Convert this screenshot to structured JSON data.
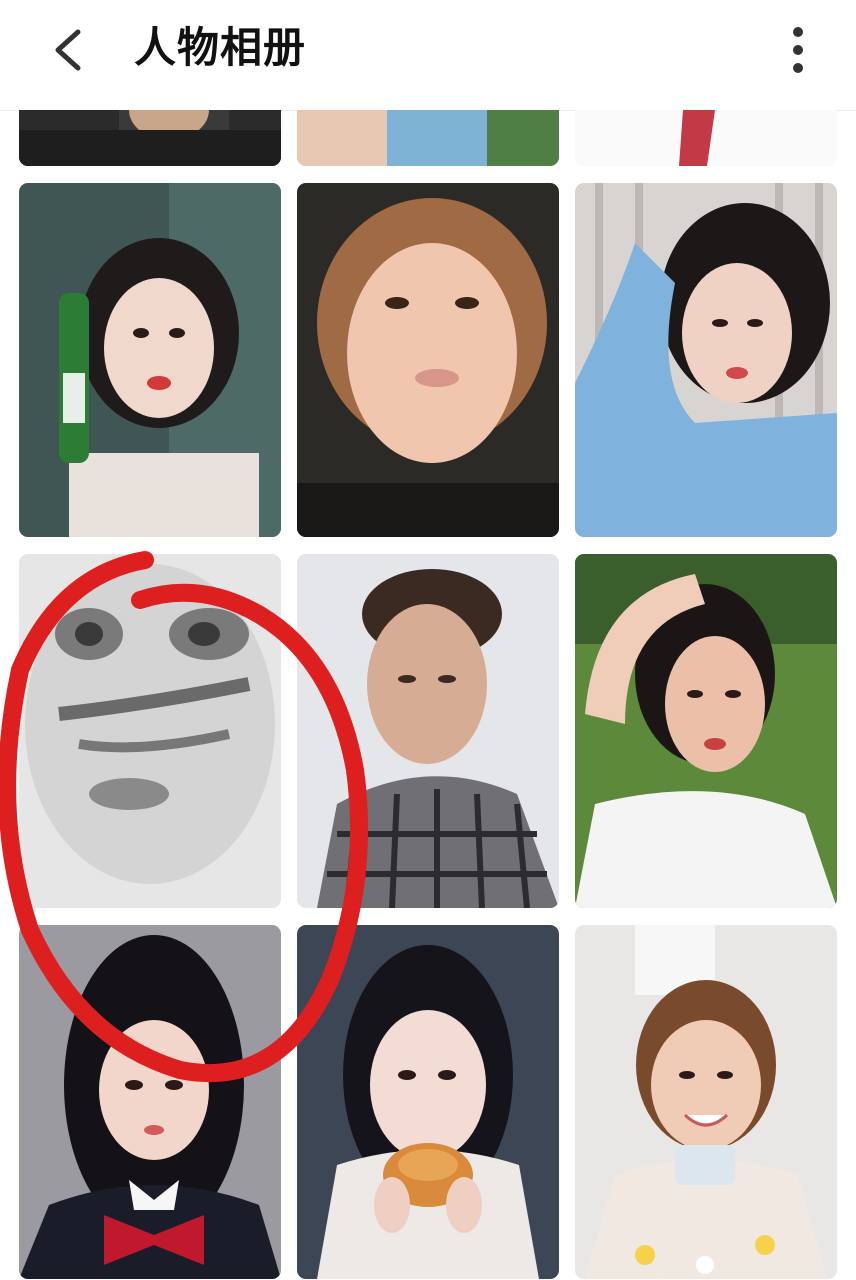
{
  "header": {
    "title": "人物相册",
    "back_icon": "chevron-left-icon",
    "more_icon": "more-vertical-icon"
  },
  "grid": {
    "columns": 3,
    "photos": [
      {
        "name": "photo-partial-1",
        "kind": "portrait-dark"
      },
      {
        "name": "photo-partial-2",
        "kind": "portrait-blue"
      },
      {
        "name": "photo-partial-3",
        "kind": "portrait-light"
      },
      {
        "name": "photo-woman-bottle",
        "kind": "portrait"
      },
      {
        "name": "photo-woman-closeup",
        "kind": "portrait"
      },
      {
        "name": "photo-woman-blue-shirt",
        "kind": "portrait"
      },
      {
        "name": "photo-meme-face",
        "kind": "meme"
      },
      {
        "name": "photo-man-plaid",
        "kind": "portrait"
      },
      {
        "name": "photo-woman-grass",
        "kind": "portrait"
      },
      {
        "name": "photo-woman-red-bow",
        "kind": "portrait"
      },
      {
        "name": "photo-woman-bread",
        "kind": "portrait"
      },
      {
        "name": "photo-woman-smiling",
        "kind": "portrait"
      }
    ]
  },
  "annotation": {
    "color": "#dd1f1f"
  },
  "colors": {
    "header_bg": "#ffffff",
    "title": "#111111",
    "icon": "#333333"
  }
}
